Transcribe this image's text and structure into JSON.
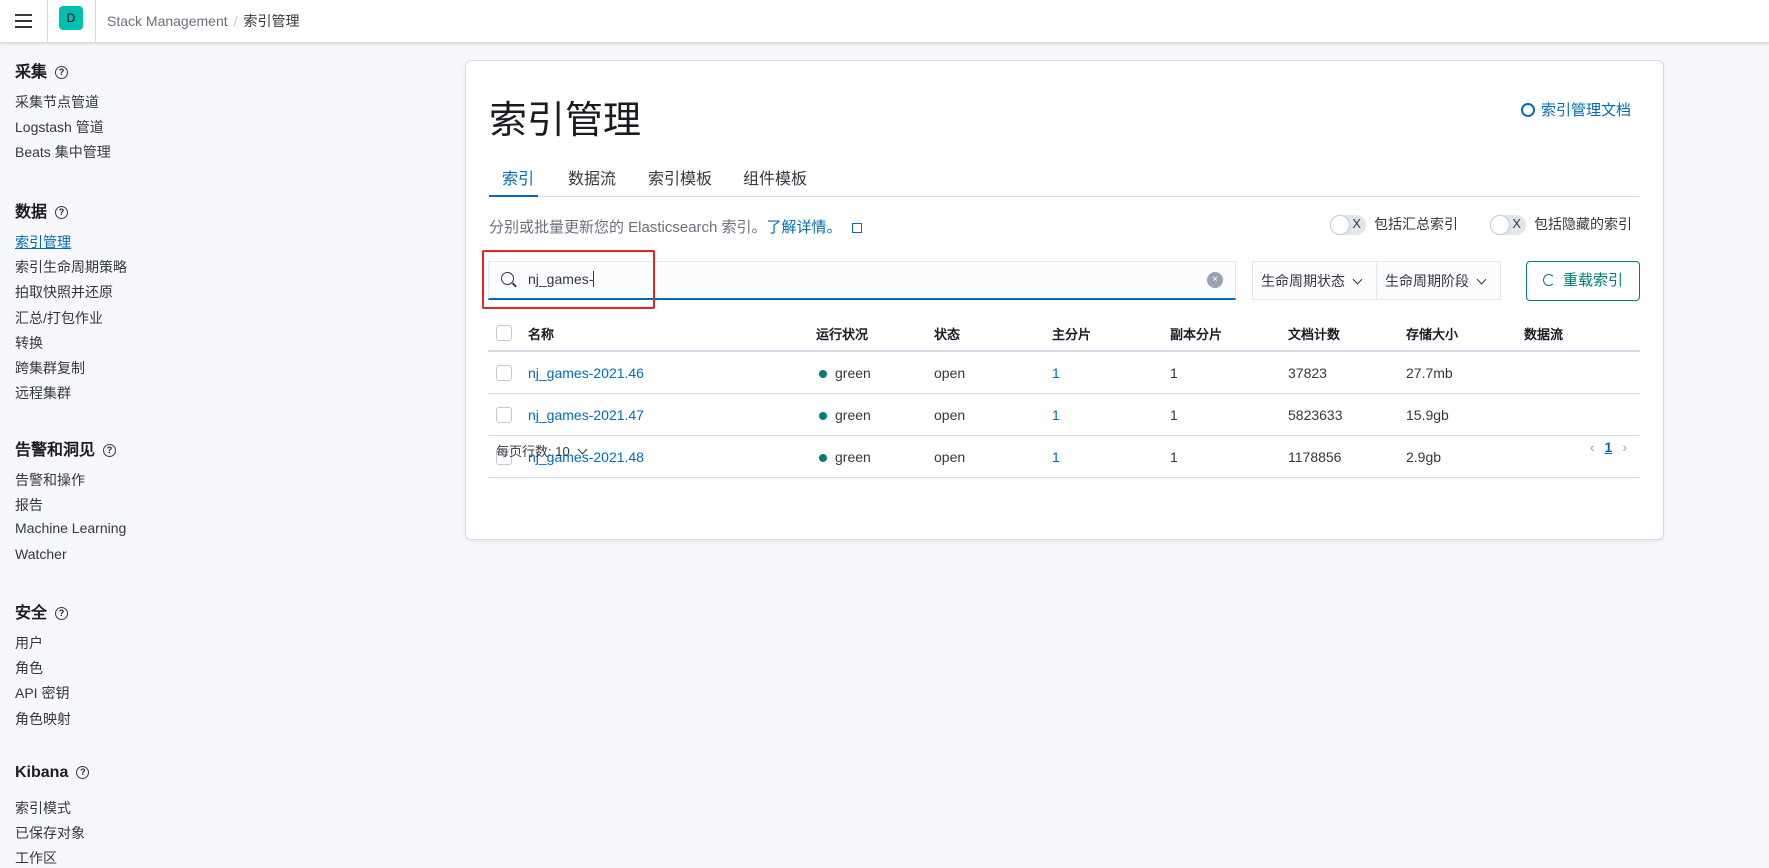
{
  "header": {
    "avatar": "D",
    "breadcrumbs": [
      "Stack Management",
      "索引管理"
    ],
    "separator": "/"
  },
  "sidebar": {
    "help": "?",
    "sections": [
      {
        "title": "采集",
        "items": [
          "采集节点管道",
          "Logstash 管道",
          "Beats 集中管理"
        ]
      },
      {
        "title": "数据",
        "items": [
          "索引管理",
          "索引生命周期策略",
          "拍取快照并还原",
          "汇总/打包作业",
          "转换",
          "跨集群复制",
          "远程集群"
        ]
      },
      {
        "title": "告警和洞见",
        "items": [
          "告警和操作",
          "报告",
          "Machine Learning",
          "Watcher"
        ]
      },
      {
        "title": "安全",
        "items": [
          "用户",
          "角色",
          "API 密钥",
          "角色映射"
        ]
      },
      {
        "title": "Kibana",
        "items": [
          "索引模式",
          "已保存对象",
          "工作区"
        ]
      }
    ]
  },
  "main": {
    "title": "索引管理",
    "doc_link": "索引管理文档",
    "tabs": [
      "索引",
      "数据流",
      "索引模板",
      "组件模板"
    ],
    "description": "分别或批量更新您的 Elasticsearch 索引。",
    "learn_more": "了解详情。",
    "toggle_rollup": "包括汇总索引",
    "toggle_hidden": "包括隐藏的索引",
    "toggle_x": "X",
    "search_value": "nj_games-",
    "clear": "×",
    "filter_lifecycle_status": "生命周期状态",
    "filter_lifecycle_phase": "生命周期阶段",
    "reload": "重载索引",
    "columns": [
      "名称",
      "运行状况",
      "状态",
      "主分片",
      "副本分片",
      "文档计数",
      "存储大小",
      "数据流"
    ],
    "rows": [
      {
        "name": "nj_games-2021.46",
        "health": "green",
        "status": "open",
        "primary": "1",
        "replica": "1",
        "docs": "37823",
        "size": "27.7mb",
        "stream": ""
      },
      {
        "name": "nj_games-2021.47",
        "health": "green",
        "status": "open",
        "primary": "1",
        "replica": "1",
        "docs": "5823633",
        "size": "15.9gb",
        "stream": ""
      },
      {
        "name": "nj_games-2021.48",
        "health": "green",
        "status": "open",
        "primary": "1",
        "replica": "1",
        "docs": "1178856",
        "size": "2.9gb",
        "stream": ""
      }
    ],
    "rows_per_page": "每页行数: 10",
    "current_page": "1",
    "prev": "‹",
    "next": "›"
  },
  "colors": {
    "accent": "#006bb8",
    "success": "#017d73",
    "highlight": "#e8231f"
  }
}
